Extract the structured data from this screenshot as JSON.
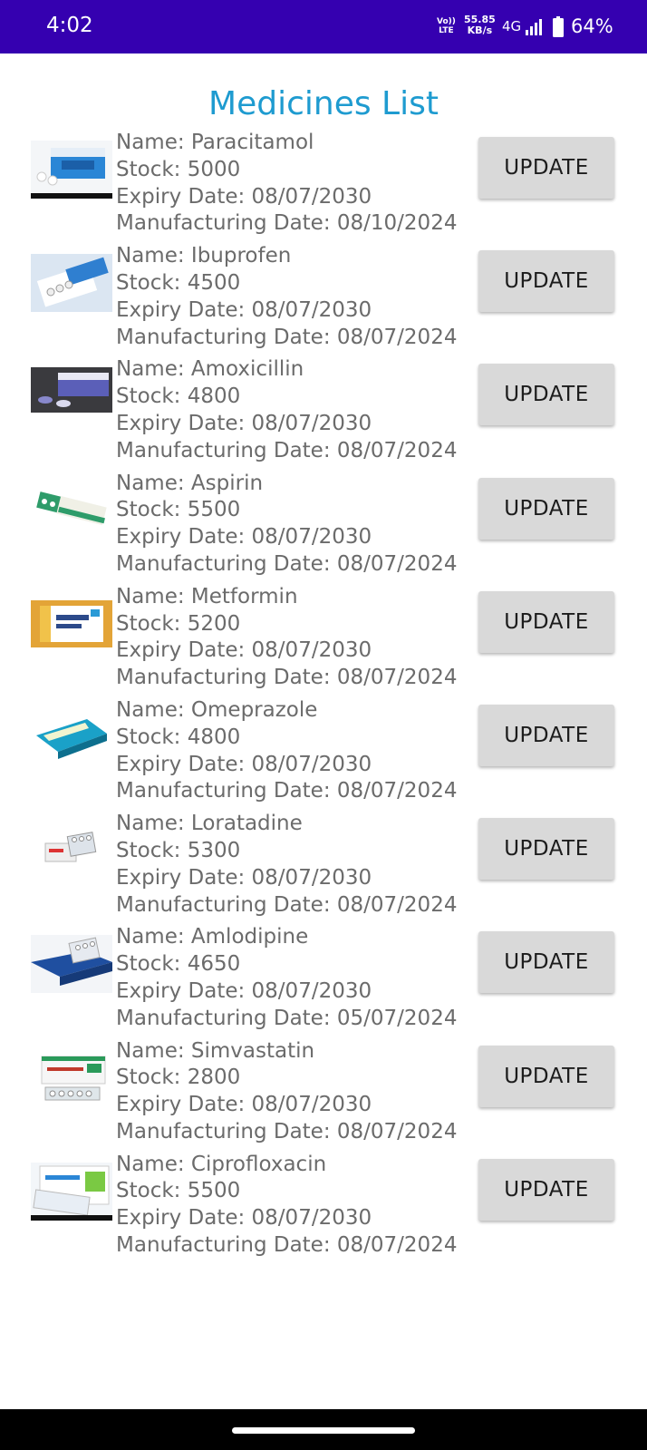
{
  "status_bar": {
    "time": "4:02",
    "volte_top": "Vo))",
    "volte_bottom": "LTE",
    "speed_value": "55.85",
    "speed_unit": "KB/s",
    "network": "4G",
    "battery": "64%",
    "signal_icon": "signal-icon",
    "battery_icon": "battery-icon"
  },
  "page": {
    "title": "Medicines List"
  },
  "medicines": [
    {
      "name": "Name: Paracitamol",
      "stock": "Stock: 5000",
      "expiry": "Expiry Date: 08/07/2030",
      "mfg": "Manufacturing Date: 08/10/2024",
      "button": "UPDATE",
      "image": "medicine-box-image"
    },
    {
      "name": "Name: Ibuprofen",
      "stock": "Stock: 4500",
      "expiry": "Expiry Date: 08/07/2030",
      "mfg": "Manufacturing Date: 08/07/2024",
      "button": "UPDATE",
      "image": "medicine-box-image"
    },
    {
      "name": "Name: Amoxicillin",
      "stock": "Stock: 4800",
      "expiry": "Expiry Date: 08/07/2030",
      "mfg": "Manufacturing Date: 08/07/2024",
      "button": "UPDATE",
      "image": "medicine-box-image"
    },
    {
      "name": "Name: Aspirin",
      "stock": "Stock: 5500",
      "expiry": "Expiry Date: 08/07/2030",
      "mfg": "Manufacturing Date: 08/07/2024",
      "button": "UPDATE",
      "image": "medicine-box-image"
    },
    {
      "name": "Name: Metformin",
      "stock": "Stock: 5200",
      "expiry": "Expiry Date: 08/07/2030",
      "mfg": "Manufacturing Date: 08/07/2024",
      "button": "UPDATE",
      "image": "medicine-box-image"
    },
    {
      "name": "Name: Omeprazole",
      "stock": "Stock: 4800",
      "expiry": "Expiry Date: 08/07/2030",
      "mfg": "Manufacturing Date: 08/07/2024",
      "button": "UPDATE",
      "image": "medicine-box-image"
    },
    {
      "name": "Name: Loratadine",
      "stock": "Stock: 5300",
      "expiry": "Expiry Date: 08/07/2030",
      "mfg": "Manufacturing Date: 08/07/2024",
      "button": "UPDATE",
      "image": "medicine-box-image"
    },
    {
      "name": "Name: Amlodipine",
      "stock": "Stock: 4650",
      "expiry": "Expiry Date: 08/07/2030",
      "mfg": "Manufacturing Date: 05/07/2024",
      "button": "UPDATE",
      "image": "medicine-box-image"
    },
    {
      "name": "Name: Simvastatin",
      "stock": "Stock: 2800",
      "expiry": "Expiry Date: 08/07/2030",
      "mfg": "Manufacturing Date: 08/07/2024",
      "button": "UPDATE",
      "image": "medicine-box-image"
    },
    {
      "name": "Name: Ciprofloxacin",
      "stock": "Stock: 5500",
      "expiry": "Expiry Date: 08/07/2030",
      "mfg": "Manufacturing Date: 08/07/2024",
      "button": "UPDATE",
      "image": "medicine-box-image"
    }
  ],
  "nav_bar": {
    "home_indicator": "home-indicator"
  },
  "colors": {
    "status_bar": "#3500b0",
    "title": "#1e9bd0",
    "text": "#6b6b6b",
    "button_bg": "#d9d9d9"
  }
}
